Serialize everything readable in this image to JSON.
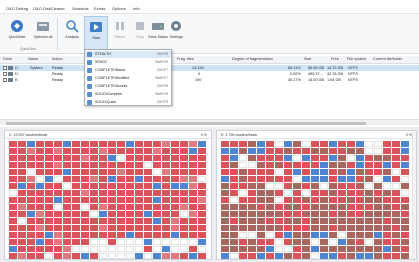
{
  "tabs": [
    {
      "label": "O&O Defrag",
      "active": false
    },
    {
      "label": "O&O DiskCleaner",
      "active": false
    },
    {
      "label": "Schedule",
      "active": false
    },
    {
      "label": "Extras",
      "active": false
    },
    {
      "label": "Options",
      "active": false
    },
    {
      "label": "Info",
      "active": false
    }
  ],
  "ribbon": {
    "buttons": [
      {
        "label": "QuickStart",
        "icon": "quickstart-icon",
        "disabled": false,
        "active": false
      },
      {
        "label": "Optimize all",
        "icon": "optimize-all-icon",
        "disabled": false,
        "active": false
      },
      {
        "label": "Analysis",
        "icon": "analysis-icon",
        "disabled": false,
        "active": false
      },
      {
        "label": "Start",
        "icon": "start-icon",
        "disabled": false,
        "active": true
      },
      {
        "label": "Pause",
        "icon": "pause-icon",
        "disabled": true,
        "active": false
      },
      {
        "label": "Stop",
        "icon": "stop-icon",
        "disabled": true,
        "active": false
      },
      {
        "label": "Drive Status",
        "icon": "drive-status-icon",
        "disabled": false,
        "active": false
      },
      {
        "label": "Settings",
        "icon": "settings-icon",
        "disabled": false,
        "active": false
      }
    ],
    "group_label": "QuickStart"
  },
  "colors": {
    "accent": "#2b6cb0",
    "used": "#d9535a",
    "used_light": "#e07a80",
    "moved": "#a9665f",
    "fragmented": "#4f84d1",
    "free": "#ffffff",
    "map_bg": "#eceef1"
  },
  "columns": [
    "Drive",
    "Name",
    "Action",
    "",
    "Frag. files",
    "Degree of fragmentation",
    "Size",
    "Free",
    "File system",
    "Current file/folder"
  ],
  "drives": [
    {
      "drive": "C:",
      "name": "System",
      "action": "Ready",
      "frag_files": "14,126",
      "degree": "60.11%",
      "size": "55.59 GB",
      "free": "14.72 GB",
      "fs": "NTFS",
      "selected": true
    },
    {
      "drive": "D:",
      "name": "",
      "action": "Ready",
      "frag_files": "0",
      "degree": "0.00%",
      "size": "495.37...",
      "free": "42.76 GB",
      "fs": "NTFS",
      "selected": false
    },
    {
      "drive": "E:",
      "name": "",
      "action": "Ready",
      "frag_files": "190",
      "degree": "30.27%",
      "size": "15.00 GB",
      "free": "1.54 GB",
      "fs": "NTFS",
      "selected": false
    }
  ],
  "menu": [
    {
      "label": "STEALTH",
      "shortcut": "Ctrl+F5",
      "highlight": true
    },
    {
      "label": "SPACE",
      "shortcut": "Shift+F5",
      "highlight": false
    },
    {
      "label": "COMPLETE/Name",
      "shortcut": "Ctrl+F7",
      "highlight": false
    },
    {
      "label": "COMPLETE/Modified",
      "shortcut": "Shift+F7",
      "highlight": false
    },
    {
      "label": "COMPLETE/Access",
      "shortcut": "Ctrl+F8",
      "highlight": false
    },
    {
      "label": "SOLID/Complete",
      "shortcut": "Shift+F8",
      "highlight": false
    },
    {
      "label": "SOLID/Quick",
      "shortcut": "Ctrl+F9",
      "highlight": false
    }
  ],
  "maps": [
    {
      "title": "C: 13 907 clusters/block",
      "percent": "0 %"
    },
    {
      "title": "E: 3 795 clusters/block",
      "percent": "0 %"
    }
  ]
}
